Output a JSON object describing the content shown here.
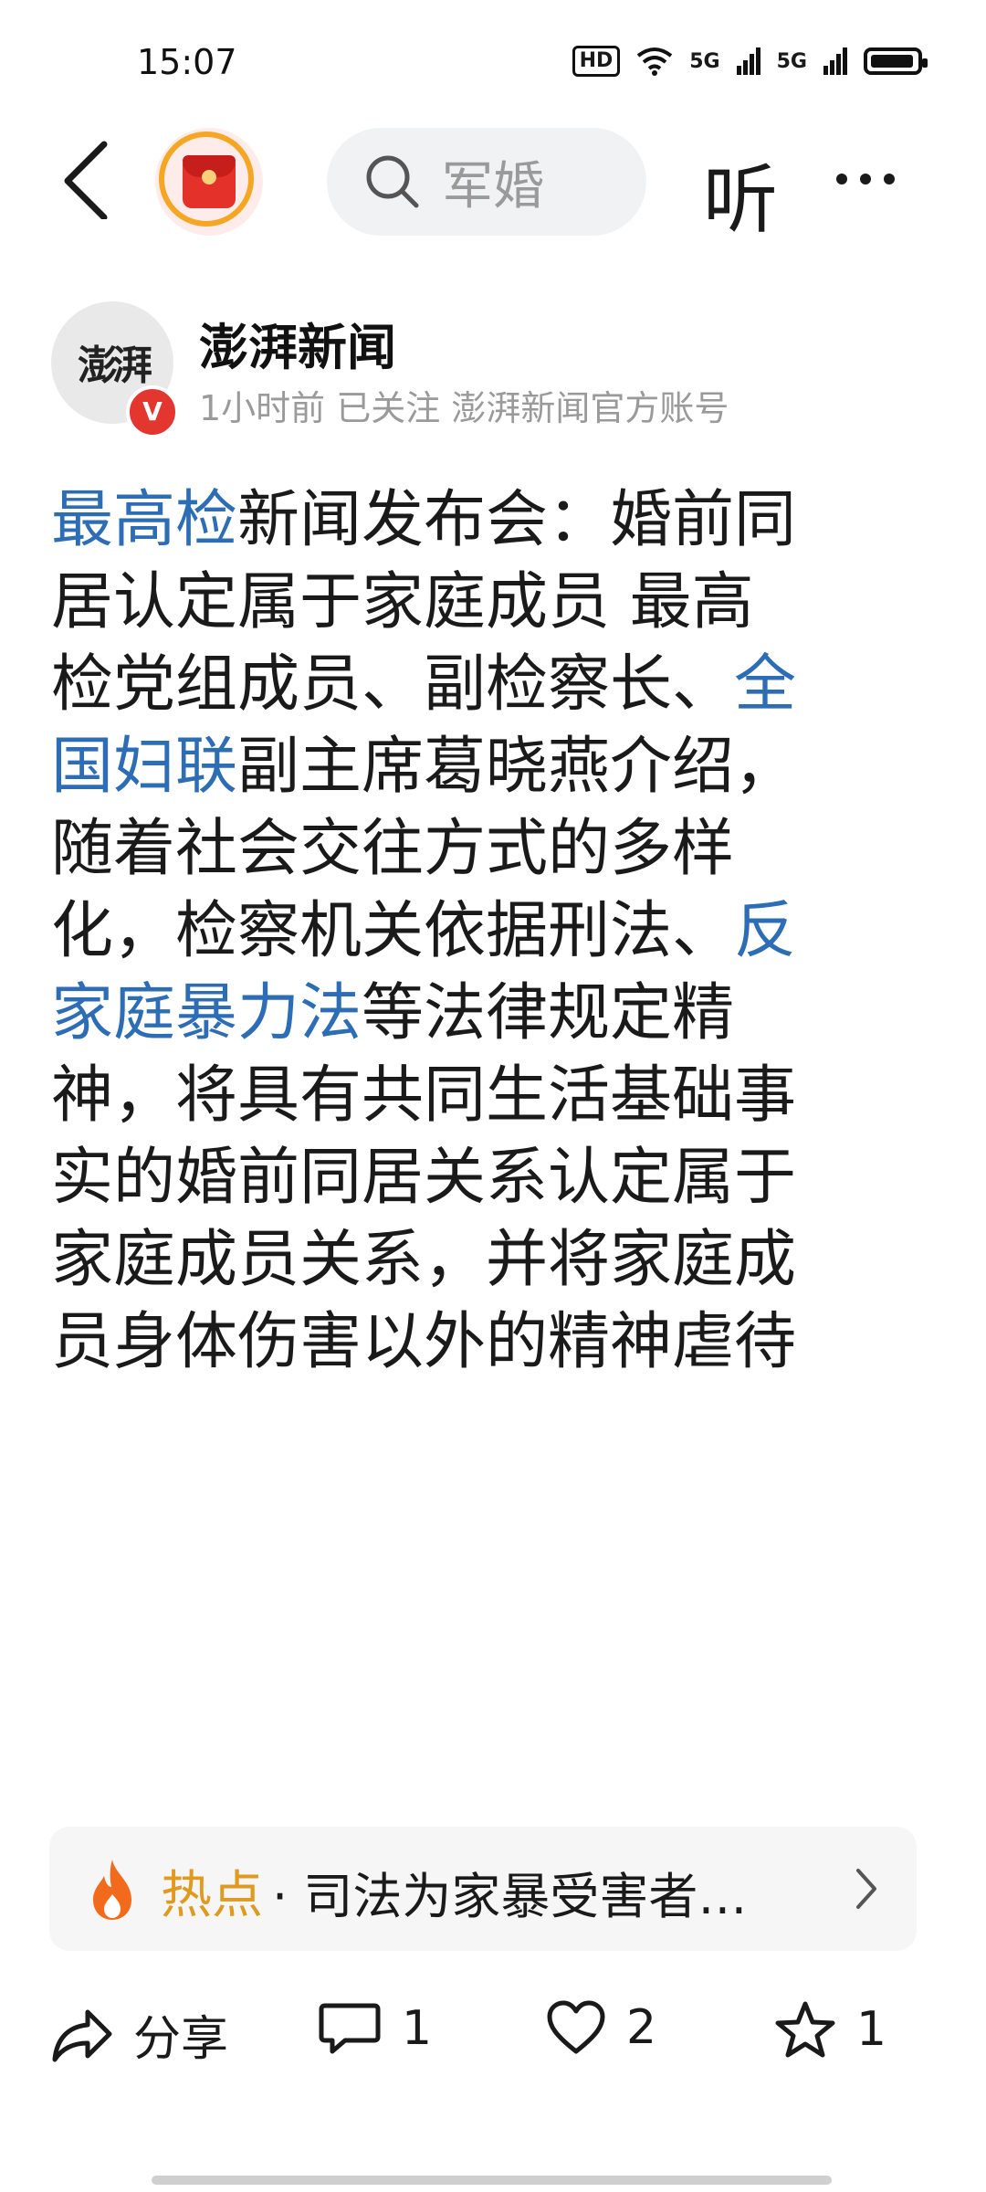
{
  "status_bar": {
    "time": "15:07",
    "hd_label": "HD",
    "signal1": "5G",
    "signal2": "5G"
  },
  "nav": {
    "search_placeholder": "军婚",
    "listen_label": "听"
  },
  "author": {
    "avatar_text": "澎湃",
    "badge": "V",
    "name": "澎湃新闻",
    "meta": "1小时前  已关注  澎湃新闻官方账号"
  },
  "article": {
    "lines": [
      [
        {
          "t": "最高检",
          "link": true
        },
        {
          "t": "新闻发布会：婚前同"
        }
      ],
      [
        {
          "t": "居认定属于家庭成员 最高"
        }
      ],
      [
        {
          "t": "检党组成员、副检察长、"
        },
        {
          "t": "全",
          "link": true
        }
      ],
      [
        {
          "t": "国妇联",
          "link": true
        },
        {
          "t": "副主席葛晓燕介绍，"
        }
      ],
      [
        {
          "t": "随着社会交往方式的多样"
        }
      ],
      [
        {
          "t": "化，检察机关依据刑法、"
        },
        {
          "t": "反",
          "link": true
        }
      ],
      [
        {
          "t": "家庭暴力法",
          "link": true
        },
        {
          "t": "等法律规定精"
        }
      ],
      [
        {
          "t": "神，将具有共同生活基础事"
        }
      ],
      [
        {
          "t": "实的婚前同居关系认定属于"
        }
      ],
      [
        {
          "t": "家庭成员关系，并将家庭成"
        }
      ],
      [
        {
          "t": "员身体伤害以外的精神虐待"
        }
      ]
    ]
  },
  "hot_topic": {
    "label": "热点",
    "text": "· 司法为家暴受害者…"
  },
  "actions": {
    "share": "分享",
    "comments": "1",
    "likes": "2",
    "favorites": "1"
  },
  "colors": {
    "link": "#2d6db5",
    "hot": "#e09a20",
    "badge": "#e2362f"
  }
}
